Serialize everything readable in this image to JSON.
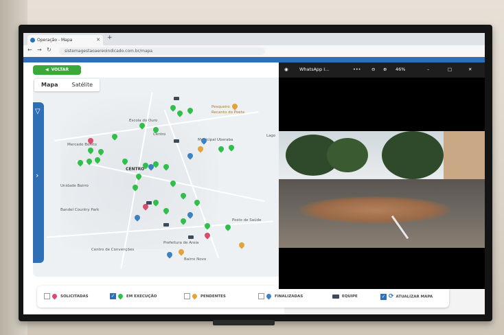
{
  "browser": {
    "tab_title": "Operação - Mapa",
    "url": "sistemagestaoaereoindicado.com.br/mapa",
    "window_controls": [
      "–",
      "□",
      "✕"
    ]
  },
  "app": {
    "back_label": "VOLTAR",
    "map_tabs": [
      "Mapa",
      "Satélite"
    ],
    "active_map_tab": "Mapa",
    "map_labels": {
      "escola_do_ouro": "Escola do Ouro",
      "pesqueiro": "Pesqueiro",
      "pesqueiro_sub": "Recanto do Poeta",
      "mercado": "Mercado Bonito",
      "uberlandia": "Centro",
      "municipal": "Municipal Uberaba",
      "centro": "CENTRO",
      "uno_bairro": "Unidade Bairro",
      "country": "Bandel Country Park",
      "prefeitura": "Prefeitura de Areia",
      "posto": "Posto de Saúde",
      "centro_convencoes": "Centro de Convenções",
      "lago": "Lago",
      "bairro_novo": "Bairro Novo"
    },
    "legend": {
      "solicitadas": "SOLICITADAS",
      "em_execucao": "EM EXECUÇÃO",
      "pendentes": "PENDENTES",
      "finalizadas": "FINALIZADAS",
      "equipe": "EQUIPE",
      "atualizar": "ATUALIZAR MAPA"
    },
    "legend_checked": {
      "em_execucao": true,
      "atualizar": true
    },
    "colors": {
      "accent": "#2f6fb5",
      "back_button": "#3aa83a",
      "pin_execucao": "#2fbf4a",
      "pin_solicitadas": "#d94c6a",
      "pin_pendentes": "#e0a43a",
      "pin_finalizadas": "#3b82c4"
    }
  },
  "whatsapp_viewer": {
    "title": "WhatsApp I...",
    "more": "•••",
    "zoom_level": "46%"
  }
}
